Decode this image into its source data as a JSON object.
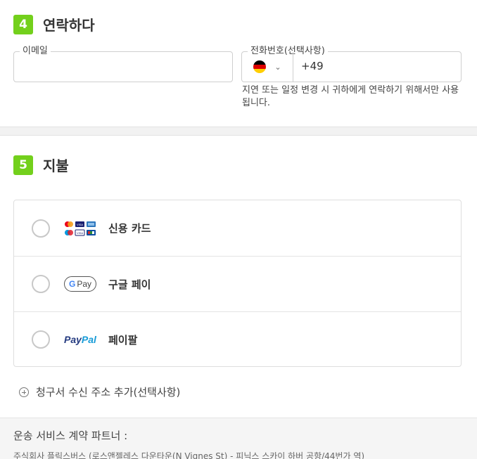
{
  "contact": {
    "step": "4",
    "title": "연락하다",
    "email_label": "이메일",
    "email_value": "",
    "phone_label": "전화번호(선택사항)",
    "country_code": "+49",
    "helper_text": "지연 또는 일정 변경 시 귀하에게 연락하기 위해서만 사용됩니다."
  },
  "payment": {
    "step": "5",
    "title": "지불",
    "options": [
      {
        "label": "신용 카드",
        "icon": "credit-cards-icon"
      },
      {
        "label": "구글 페이",
        "icon": "google-pay-icon"
      },
      {
        "label": "페이팔",
        "icon": "paypal-icon"
      }
    ],
    "gpay_g": "G",
    "gpay_text": "Pay",
    "paypal_a": "Pay",
    "paypal_b": "Pal"
  },
  "billing": {
    "add_label": "청구서 수신 주소 추가(선택사항)"
  },
  "footer": {
    "title": "운송 서비스 계약 파트너 :",
    "text": "주식회사 플릭스버스 (로스앤젤레스 다운타운(N Vignes St) - 피닉스 스카이 하버 공항/44번가 역)"
  },
  "colors": {
    "accent_green": "#73d01c",
    "flag_black": "#000000",
    "flag_red": "#dd0000",
    "flag_gold": "#ffce00"
  }
}
